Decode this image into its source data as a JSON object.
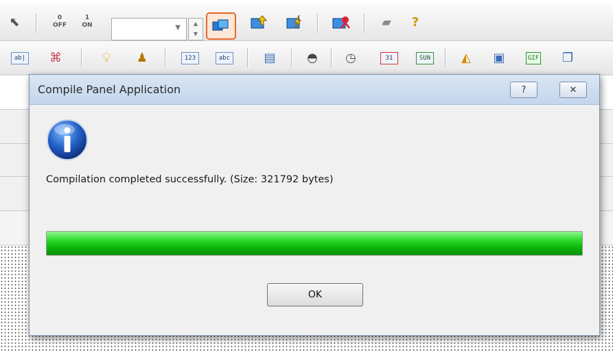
{
  "toolbar1": {
    "off_label": "OFF",
    "on_label": "ON",
    "zero_label": "0",
    "one_label": "1",
    "combo_value": ""
  },
  "toolbar2": {
    "numeric_label": "123",
    "text_label": "abc",
    "calendar_label": "31",
    "sun_label": "SUN",
    "gif_label": "GIF"
  },
  "dialog": {
    "title": "Compile Panel Application",
    "help_glyph": "?",
    "close_glyph": "✕",
    "message": "Compilation completed successfully. (Size: 321792 bytes)",
    "progress_percent": 100,
    "ok_label": "OK",
    "accent_color": "#1fd11f"
  }
}
